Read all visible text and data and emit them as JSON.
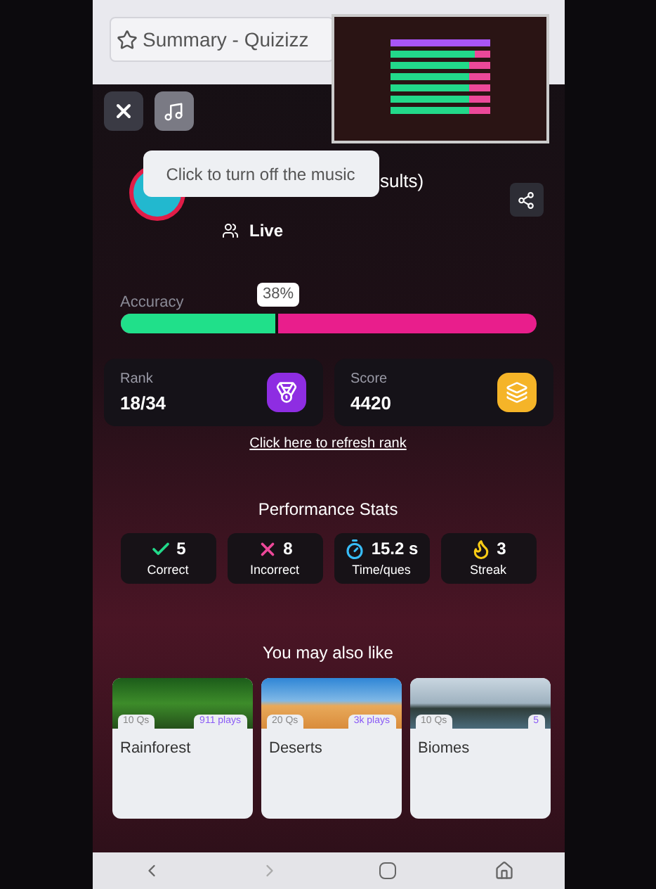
{
  "browser": {
    "title": "Summary - Quizizz"
  },
  "tooltip": "Click to turn off the music",
  "quiz": {
    "title_fragment": "sults)",
    "mode": "Live"
  },
  "accuracy": {
    "label": "Accuracy",
    "level": 0.38,
    "reading": "38%"
  },
  "summary_cards": [
    {
      "kind": "rank",
      "label": "Rank",
      "value": "18/34"
    },
    {
      "kind": "score",
      "label": "Score",
      "value": "4420"
    }
  ],
  "refresh_link": "Click here to refresh rank",
  "performance": {
    "title": "Performance Stats",
    "items": [
      {
        "kind": "correct",
        "value": "5",
        "label": "Correct"
      },
      {
        "kind": "incorrect",
        "value": "8",
        "label": "Incorrect"
      },
      {
        "kind": "time",
        "value": "15.2 s",
        "label": "Time/ques"
      },
      {
        "kind": "streak",
        "value": "3",
        "label": "Streak"
      }
    ]
  },
  "recommendations": {
    "title": "You may also like",
    "items": [
      {
        "kind": "forest",
        "questions": "10 Qs",
        "plays": "911 plays",
        "title": "Rainforest"
      },
      {
        "kind": "desert",
        "questions": "20 Qs",
        "plays": "3k plays",
        "title": "Deserts"
      },
      {
        "kind": "lake",
        "questions": "10 Qs",
        "plays": "5",
        "title": "Biomes"
      }
    ]
  }
}
